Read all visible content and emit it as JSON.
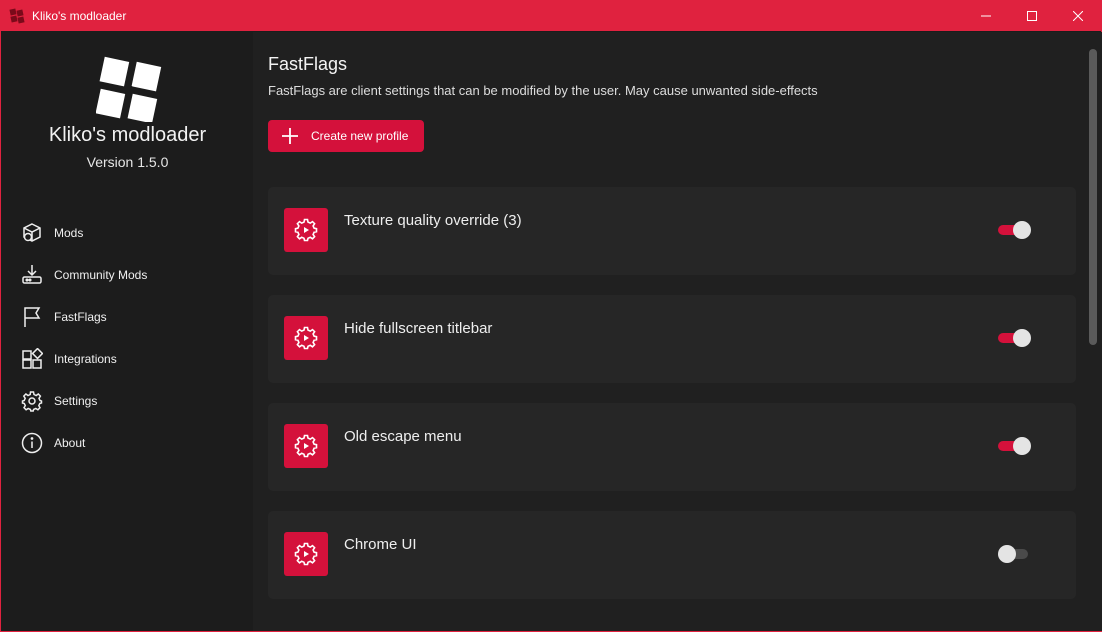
{
  "window": {
    "title": "Kliko's modloader",
    "accent": "#e0223f",
    "controls": [
      "minimize-icon",
      "maximize-icon",
      "close-icon"
    ]
  },
  "sidebar": {
    "app_name": "Kliko's modloader",
    "version": "Version 1.5.0",
    "items": [
      {
        "label": "Mods",
        "icon": "package-icon"
      },
      {
        "label": "Community Mods",
        "icon": "download-icon"
      },
      {
        "label": "FastFlags",
        "icon": "flag-icon"
      },
      {
        "label": "Integrations",
        "icon": "apps-icon"
      },
      {
        "label": "Settings",
        "icon": "gear-icon"
      },
      {
        "label": "About",
        "icon": "info-icon"
      }
    ]
  },
  "main": {
    "title": "FastFlags",
    "description": "FastFlags are client settings that can be modified by the user. May cause unwanted side-effects",
    "create_button": "Create new profile",
    "flags": [
      {
        "name": "Texture quality override (3)",
        "enabled": true
      },
      {
        "name": "Hide fullscreen titlebar",
        "enabled": true
      },
      {
        "name": "Old escape menu",
        "enabled": true
      },
      {
        "name": "Chrome UI",
        "enabled": false
      }
    ]
  }
}
